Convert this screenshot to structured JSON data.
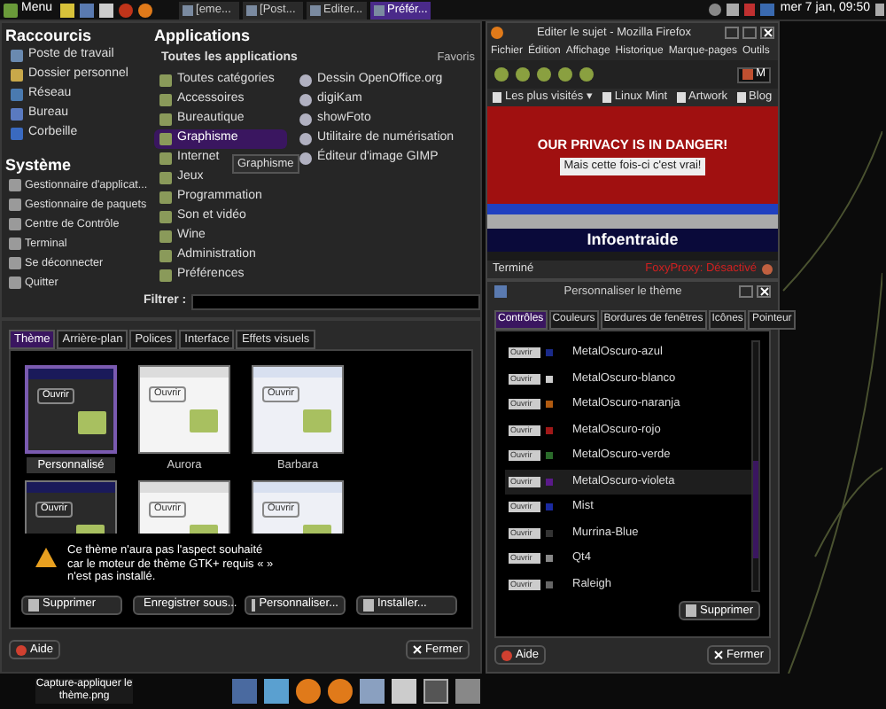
{
  "top_panel": {
    "menu_label": "Menu",
    "tasks": [
      {
        "label": "[eme...",
        "selected": false
      },
      {
        "label": "[Post...",
        "selected": false
      },
      {
        "label": "Editer...",
        "selected": false
      },
      {
        "label": "Préfér...",
        "selected": true
      }
    ],
    "clock": "mer 7 jan, 09:50"
  },
  "menu": {
    "shortcuts_title": "Raccourcis",
    "shortcuts": [
      "Poste de travail",
      "Dossier personnel",
      "Réseau",
      "Bureau",
      "Corbeille"
    ],
    "system_title": "Système",
    "system": [
      "Gestionnaire d'applicat...",
      "Gestionnaire de paquets",
      "Centre de Contrôle",
      "Terminal",
      "Se déconnecter",
      "Quitter"
    ],
    "apps_title": "Applications",
    "apps_header": "Toutes les applications",
    "apps": [
      {
        "label": "Toutes catégories",
        "selected": false
      },
      {
        "label": "Accessoires",
        "selected": false
      },
      {
        "label": "Bureautique",
        "selected": false
      },
      {
        "label": "Graphisme",
        "selected": true
      },
      {
        "label": "Internet",
        "selected": false
      },
      {
        "label": "Jeux",
        "selected": false
      },
      {
        "label": "Programmation",
        "selected": false
      },
      {
        "label": "Son et vidéo",
        "selected": false
      },
      {
        "label": "Wine",
        "selected": false
      },
      {
        "label": "Administration",
        "selected": false
      },
      {
        "label": "Préférences",
        "selected": false
      }
    ],
    "tooltip": "Graphisme",
    "favorites_title": "Favoris",
    "favorites": [
      "Dessin OpenOffice.org",
      "digiKam",
      "showFoto",
      "Utilitaire de numérisation",
      "Éditeur d'image GIMP"
    ],
    "filter_label": "Filtrer :"
  },
  "theme_dialog": {
    "tabs": [
      {
        "label": "Thème",
        "selected": true
      },
      {
        "label": "Arrière-plan",
        "selected": false
      },
      {
        "label": "Polices",
        "selected": false
      },
      {
        "label": "Interface",
        "selected": false
      },
      {
        "label": "Effets visuels",
        "selected": false
      }
    ],
    "themes": [
      {
        "label": "Personnalisé",
        "selected": true,
        "kind": "dark",
        "preview_text": "Ouvrir"
      },
      {
        "label": "Aurora",
        "selected": false,
        "kind": "light",
        "preview_text": "Ouvrir"
      },
      {
        "label": "Barbara",
        "selected": false,
        "kind": "blue",
        "preview_text": "Ouvrir"
      },
      {
        "selected": false,
        "kind": "dark",
        "preview_text": "Ouvrir"
      },
      {
        "selected": false,
        "kind": "light",
        "preview_text": "Ouvrir"
      },
      {
        "selected": false,
        "kind": "blue",
        "preview_text": "Ouvrir"
      }
    ],
    "warning": "Ce thème n'aura pas l'aspect souhaité car le moteur de thème GTK+ requis « » n'est pas installé.",
    "buttons": [
      "Supprimer",
      "Enregistrer sous...",
      "Personnaliser...",
      "Installer..."
    ],
    "help": "Aide",
    "close": "Fermer"
  },
  "firefox": {
    "title": "Editer le sujet - Mozilla Firefox",
    "menu": [
      "Fichier",
      "Édition",
      "Affichage",
      "Historique",
      "Marque-pages",
      "Outils"
    ],
    "url_text": "M",
    "bookmarks": [
      "Les plus visités ▾",
      "Linux Mint",
      "Artwork",
      "Blog"
    ],
    "banner": "OUR PRIVACY IS IN DANGER!",
    "subtitle": "Mais cette fois-ci c'est vrai!",
    "site": "Infoentraide",
    "status": "Terminé",
    "proxy": "FoxyProxy: Désactivé"
  },
  "customize": {
    "title": "Personnaliser le thème",
    "tabs": [
      {
        "label": "Contrôles",
        "selected": true
      },
      {
        "label": "Couleurs",
        "selected": false
      },
      {
        "label": "Bordures de fenêtres",
        "selected": false
      },
      {
        "label": "Icônes",
        "selected": false
      },
      {
        "label": "Pointeur",
        "selected": false
      }
    ],
    "themes": [
      {
        "label": "MetalOscuro-azul",
        "selected": false,
        "color": "#1a2a8a",
        "preview_text": "Ouvrir"
      },
      {
        "label": "MetalOscuro-blanco",
        "selected": false,
        "color": "#cccccc",
        "preview_text": "Ouvrir"
      },
      {
        "label": "MetalOscuro-naranja",
        "selected": false,
        "color": "#b05a10",
        "preview_text": "Ouvrir"
      },
      {
        "label": "MetalOscuro-rojo",
        "selected": false,
        "color": "#a01818",
        "preview_text": "Ouvrir"
      },
      {
        "label": "MetalOscuro-verde",
        "selected": false,
        "color": "#2a6a2a",
        "preview_text": "Ouvrir"
      },
      {
        "label": "MetalOscuro-violeta",
        "selected": true,
        "color": "#5a1a8a",
        "preview_text": "Ouvrir"
      },
      {
        "label": "Mist",
        "selected": false,
        "color": "#1a2aa0",
        "preview_text": "Ouvrir"
      },
      {
        "label": "Murrina-Blue",
        "selected": false,
        "color": "#333333",
        "preview_text": "Ouvrir"
      },
      {
        "label": "Qt4",
        "selected": false,
        "color": "#888888",
        "preview_text": "Ouvrir"
      },
      {
        "label": "Raleigh",
        "selected": false,
        "color": "#666666",
        "preview_text": "Ouvrir"
      }
    ],
    "delete": "Supprimer",
    "help": "Aide",
    "close": "Fermer"
  },
  "taskbar": {
    "file_label": "Capture-appliquer le thème.png"
  }
}
